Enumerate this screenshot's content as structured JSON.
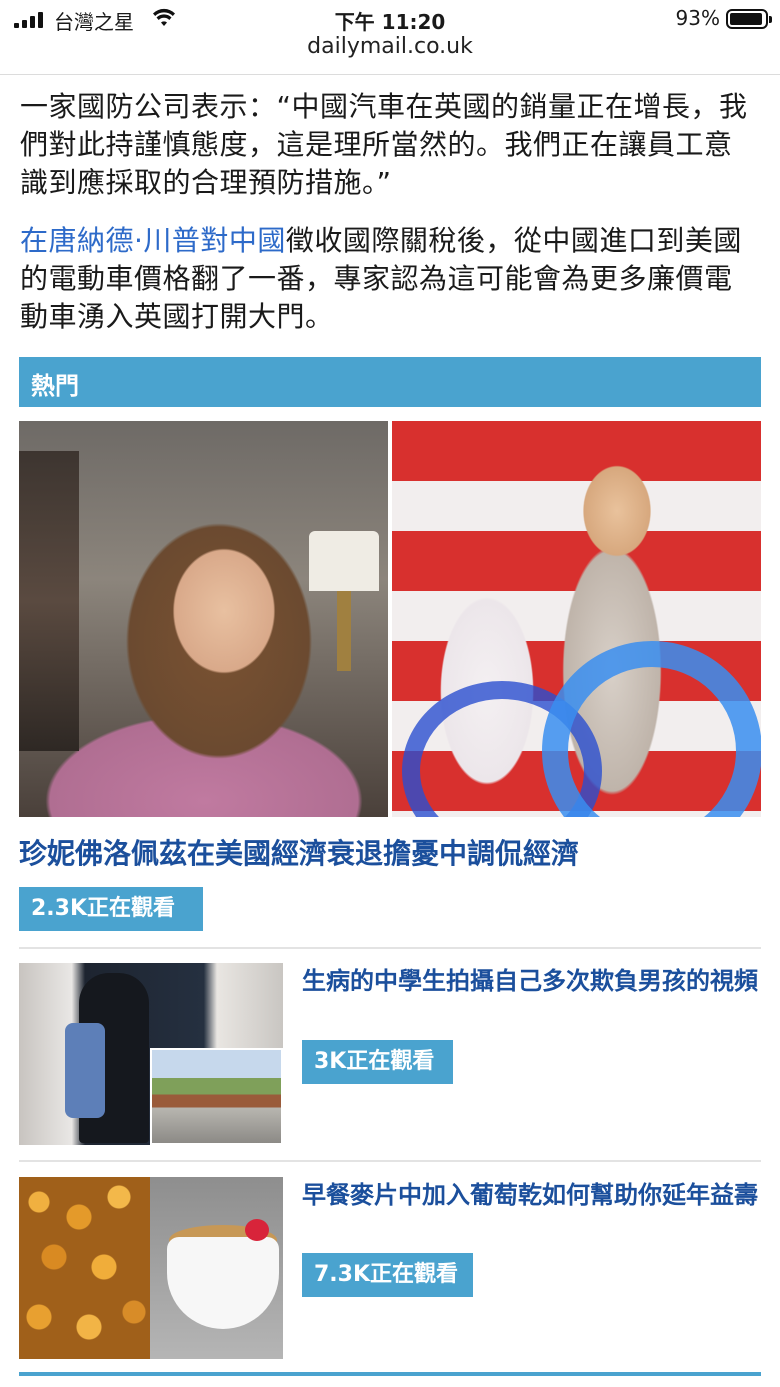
{
  "status_bar": {
    "carrier": "台灣之星",
    "time": "下午 11:20",
    "battery": "93%",
    "battery_level": 0.93
  },
  "browser": {
    "url": "dailymail.co.uk"
  },
  "article": {
    "paragraph1": "一家國防公司表示：“中國汽車在英國的銷量正在增長，我們對此持謹慎態度，這是理所當然的。我們正在讓員工意識到應採取的合理預防措施。”",
    "paragraph2_link": "在唐納德·川普對中國",
    "paragraph2_rest": "徵收國際關稅後，從中國進口到美國的電動車價格翻了一番，專家認為這可能會為更多廉價電動車湧入英國打開大門。"
  },
  "trending": {
    "header": "熱門",
    "featured": {
      "title": "珍妮佛洛佩茲在美國經濟衰退擔憂中調侃經濟",
      "watching": "2.3K正在觀看"
    },
    "stories": [
      {
        "title": "生病的中學生拍攝自己多次欺負男孩的視頻",
        "watching": "3K正在觀看"
      },
      {
        "title": "早餐麥片中加入葡萄乾如何幫助你延年益壽",
        "watching": "7.3K正在觀看"
      }
    ]
  },
  "colors": {
    "accent": "#4aa3cf",
    "headline": "#1b4f9c",
    "link": "#2d6ac9"
  }
}
